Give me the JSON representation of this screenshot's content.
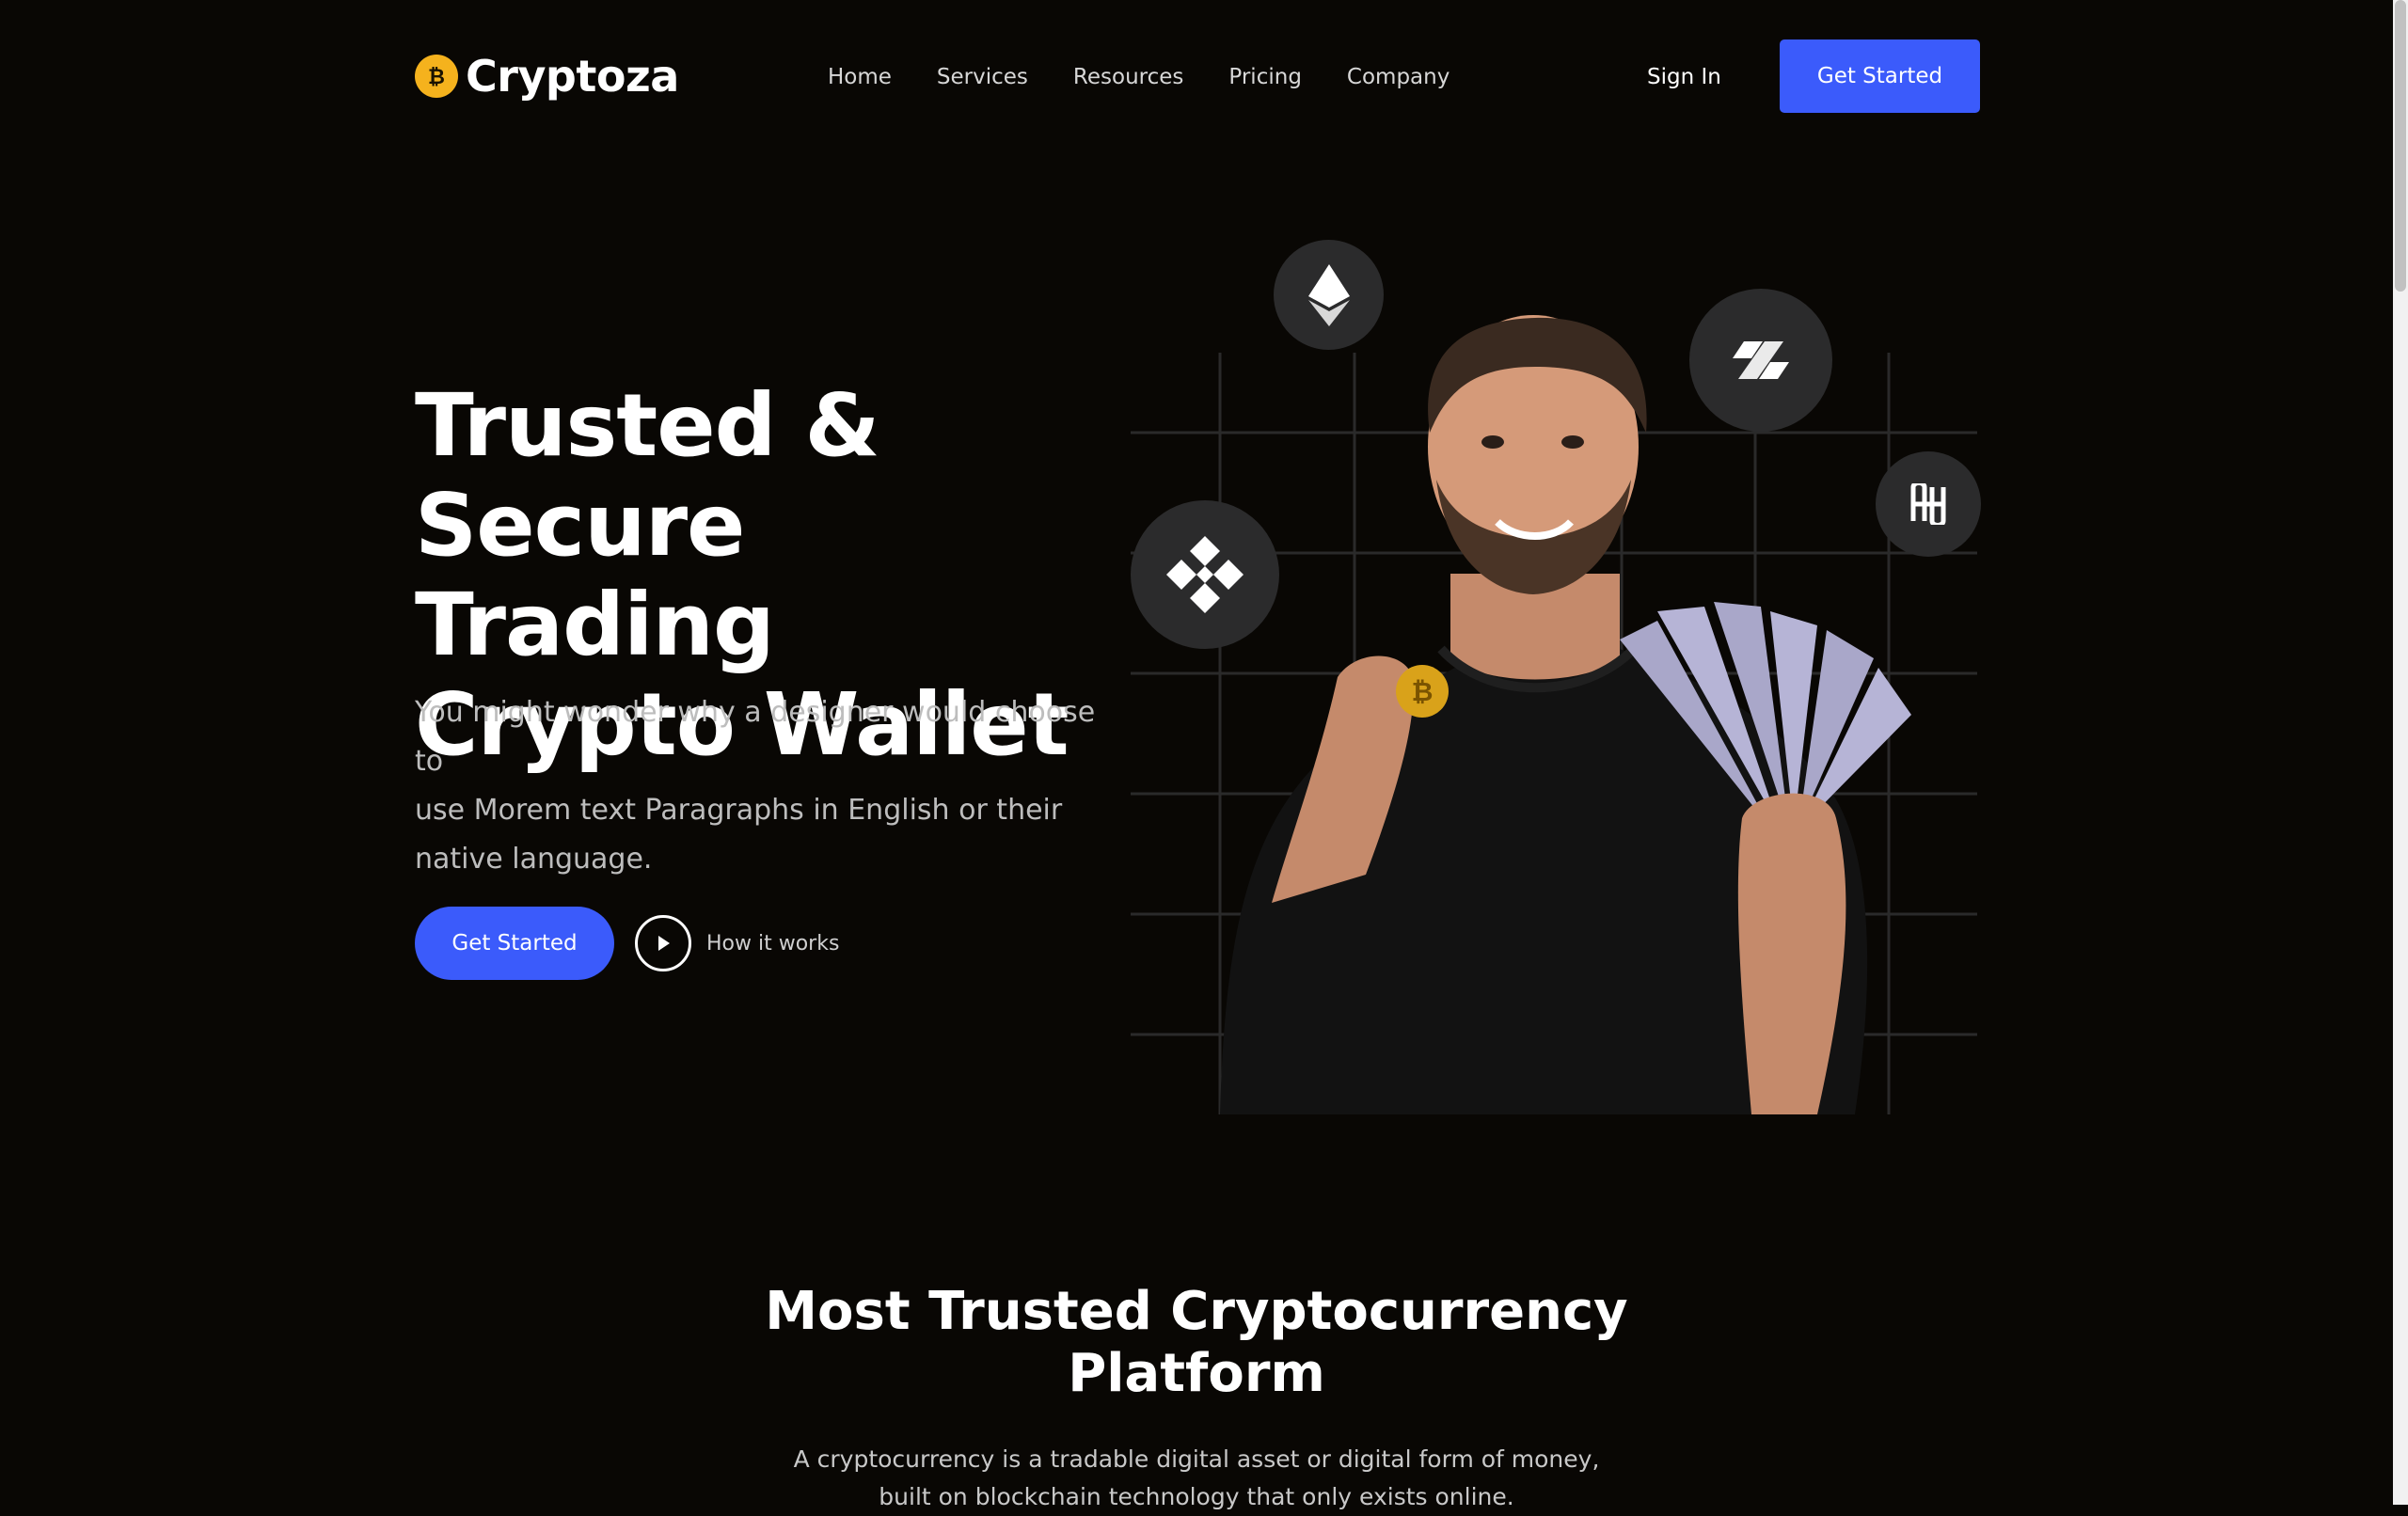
{
  "brand": {
    "name": "Cryptoza",
    "logo_icon": "bitcoin-coin-icon",
    "accent": "#3b5bfb",
    "coin_color": "#f5b21d"
  },
  "nav": {
    "items": [
      {
        "label": "Home"
      },
      {
        "label": "Services"
      },
      {
        "label": "Resources"
      },
      {
        "label": "Pricing"
      },
      {
        "label": "Company"
      }
    ],
    "sign_in": "Sign In",
    "cta": "Get Started"
  },
  "hero": {
    "title_lines": [
      "Trusted &",
      "Secure Trading",
      "Crypto Wallet"
    ],
    "subtitle_lines": [
      "You might wonder why a designer would choose to",
      "use Morem text Paragraphs in English or their",
      "native language."
    ],
    "cta": "Get Started",
    "secondary": "How it works",
    "coin_icons": [
      "ethereum-icon",
      "horizen-icon",
      "binance-icon",
      "harmony-icon"
    ]
  },
  "section": {
    "title_lines": [
      "Most Trusted Cryptocurrency",
      "Platform"
    ],
    "subtitle_lines": [
      "A cryptocurrency is a tradable digital asset or digital form of money,",
      "built on blockchain technology that only exists online."
    ]
  }
}
